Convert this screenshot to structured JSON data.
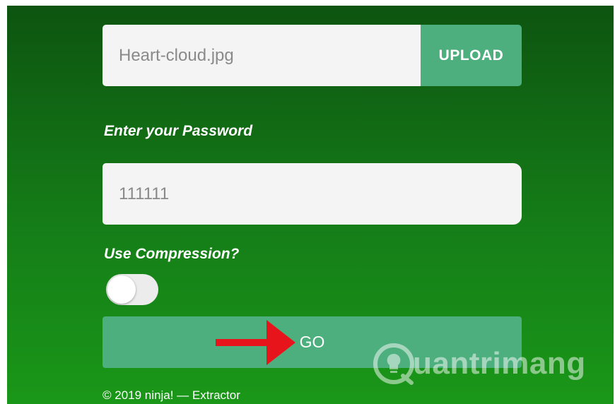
{
  "upload": {
    "file_name": "Heart-cloud.jpg",
    "button_label": "UPLOAD"
  },
  "password": {
    "label": "Enter your Password",
    "value": "111111"
  },
  "compression": {
    "label": "Use Compression?",
    "enabled": false
  },
  "go": {
    "button_label": "GO"
  },
  "footer": {
    "text": "© 2019 ninja! — Extractor"
  },
  "watermark": {
    "text": "uantrimang",
    "icon": "lightbulb-q-icon"
  },
  "colors": {
    "accent": "#4caf7d",
    "background_top": "#0d5410",
    "background_bottom": "#1a9718",
    "arrow": "#e8141b"
  }
}
